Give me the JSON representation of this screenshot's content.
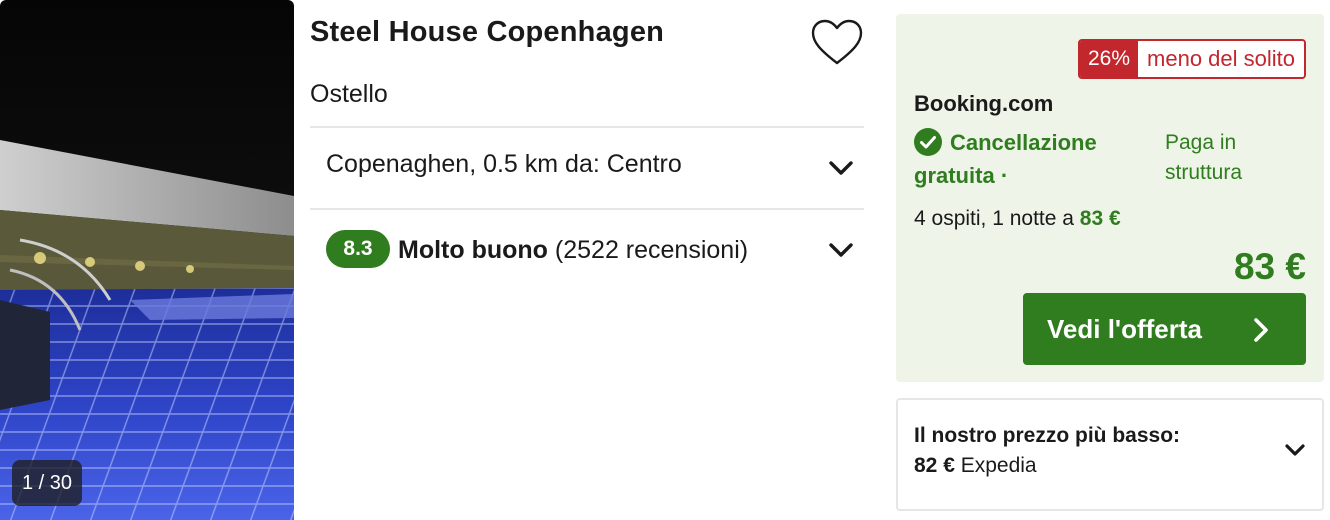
{
  "photo": {
    "counter": "1 / 30"
  },
  "hotel": {
    "name": "Steel House Copenhagen",
    "type": "Ostello",
    "location": "Copenaghen, 0.5 km da: Centro",
    "rating": {
      "score": "8.3",
      "label": "Molto buono",
      "reviews": "(2522 recensioni)"
    }
  },
  "offer": {
    "discount_pct": "26%",
    "discount_text": "meno del solito",
    "provider": "Booking.com",
    "cancellation": "Cancellazione gratuita",
    "separator": "·",
    "payment": "Paga in struttura",
    "guests_prefix": "4 ospiti, 1 notte a",
    "guests_price": "83 €",
    "price": "83 €",
    "cta_label": "Vedi l'offerta"
  },
  "lowest": {
    "title": "Il nostro prezzo più basso:",
    "price": "82 €",
    "provider": "Expedia"
  },
  "colors": {
    "accent_green": "#2f7d1e",
    "discount_red": "#c1272d",
    "offer_bg": "#eef4e8"
  },
  "icons": [
    "heart-icon",
    "chevron-down-icon",
    "check-circle-icon",
    "chevron-right-icon"
  ]
}
